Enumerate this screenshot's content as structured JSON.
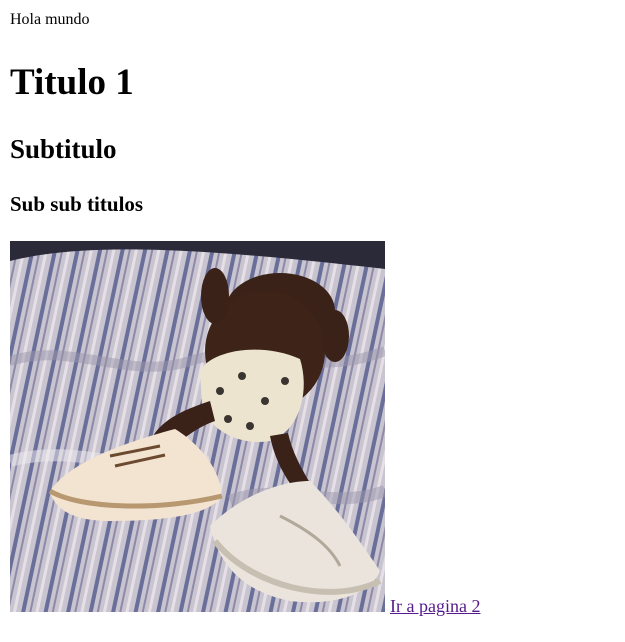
{
  "page": {
    "greeting": "Hola mundo",
    "heading1": "Titulo 1",
    "heading2": "Subtitulo",
    "heading3": "Sub sub titulos",
    "link_text": "Ir a pagina 2"
  },
  "image": {
    "subject": "baby-in-diaper-on-bed-with-sneakers"
  },
  "colors": {
    "link_visited": "#551a8b",
    "text": "#000000",
    "background": "#ffffff"
  }
}
